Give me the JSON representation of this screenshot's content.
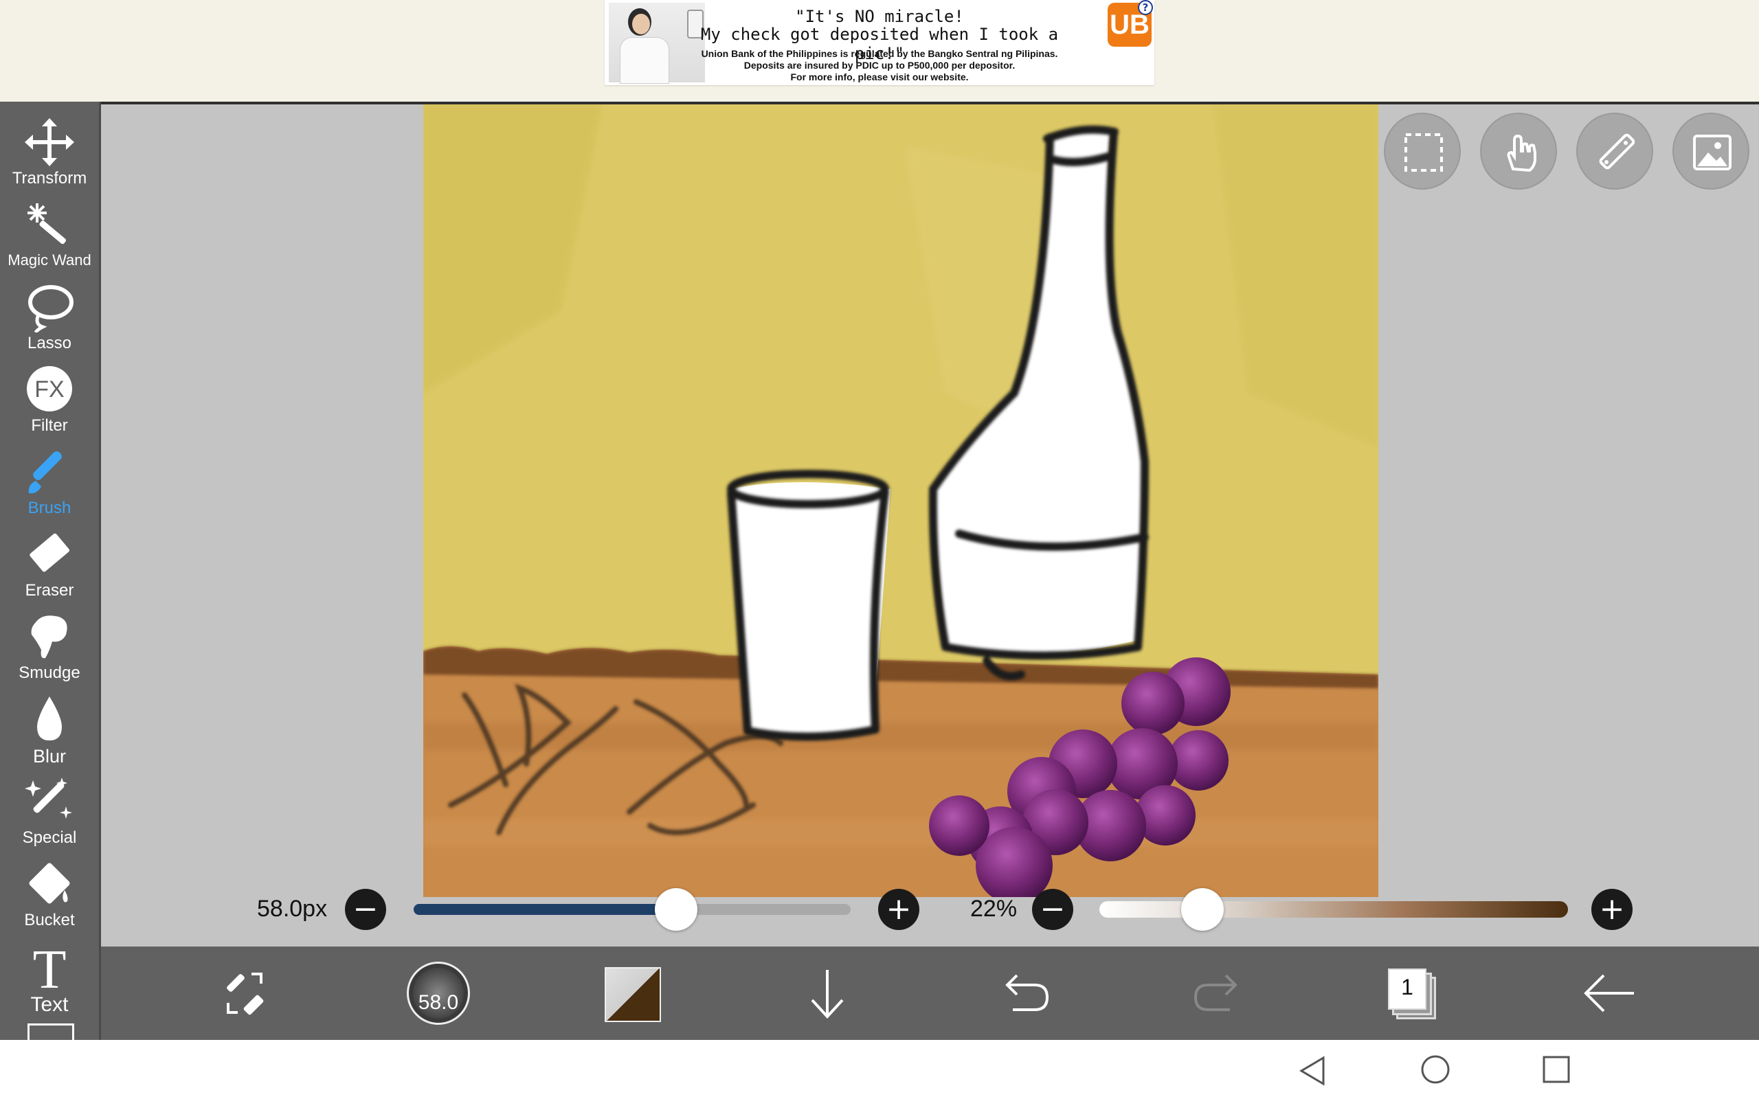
{
  "ad": {
    "headline_1": "\"It's NO miracle!",
    "headline_2": "My check got deposited when I took a pic!\"",
    "disclaimer": "Union Bank of the Philippines is regulated by the Bangko Sentral ng Pilipinas.\nDeposits are insured by PDIC up to P500,000 per depositor.\nFor more info, please visit our website.",
    "logo": "UB",
    "info_icon": "?"
  },
  "toolbar": {
    "items": [
      {
        "label": "Transform",
        "icon": "move-arrows-icon"
      },
      {
        "label": "Magic Wand",
        "icon": "magic-wand-icon"
      },
      {
        "label": "Lasso",
        "icon": "lasso-icon"
      },
      {
        "label": "Filter",
        "icon": "fx-icon"
      },
      {
        "label": "Brush",
        "icon": "brush-icon",
        "active": true
      },
      {
        "label": "Eraser",
        "icon": "eraser-icon"
      },
      {
        "label": "Smudge",
        "icon": "smudge-icon"
      },
      {
        "label": "Blur",
        "icon": "droplet-icon"
      },
      {
        "label": "Special",
        "icon": "sparkle-pen-icon"
      },
      {
        "label": "Bucket",
        "icon": "bucket-icon"
      },
      {
        "label": "Text",
        "icon": "text-icon"
      }
    ],
    "accent": "#3aa3f5"
  },
  "top_buttons": [
    "selection-icon",
    "hand-icon",
    "ruler-icon",
    "image-icon"
  ],
  "brush_size": {
    "label": "58.0px",
    "fraction": 0.6
  },
  "opacity": {
    "label": "22%",
    "fraction": 0.22
  },
  "bottom_bar": {
    "brush_badge": "58.0",
    "layer_count": "1",
    "primary_color": "#4a2e10",
    "icons": [
      "swap-tools-icon",
      "brush-preview-icon",
      "color-swatch-icon",
      "download-icon",
      "undo-icon",
      "redo-icon",
      "layers-icon",
      "back-icon"
    ]
  },
  "canvas_colors": {
    "wall": "#dcc865",
    "table": "#c98a4a",
    "grape": "#7a2a78"
  }
}
